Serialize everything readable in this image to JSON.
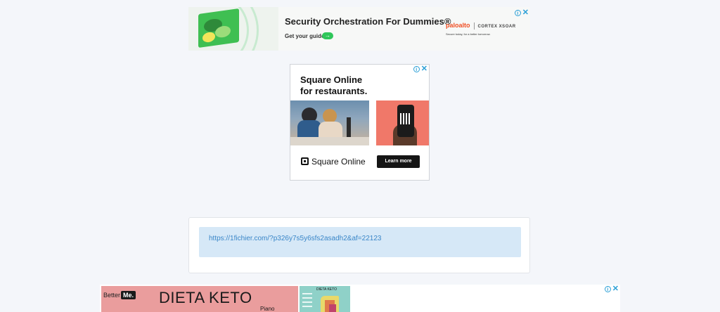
{
  "ad_top": {
    "title": "Security Orchestration For Dummies®",
    "cta": "Get your guide",
    "cta_arrow": "→",
    "brand_logo": "paloalto",
    "brand_product": "CORTEX XSOAR",
    "tagline": "Secure today, for a better tomorrow.",
    "info_icon": "i",
    "close_icon": "✕"
  },
  "ad_square": {
    "headline_line1": "Square Online",
    "headline_line2": "for restaurants.",
    "brand_name": "Square Online",
    "cta": "Learn more",
    "info_icon": "i",
    "close_icon": "✕"
  },
  "link_card": {
    "url": "https://1fichier.com/?p326y7s5y6sfs2asadh2&af=22123"
  },
  "ad_bottom": {
    "brand_prefix": "Better",
    "brand_badge": "Me.",
    "headline": "DIETA KETO",
    "subline": "Piano",
    "mini_title": "DIETA KETO",
    "info_icon": "i",
    "close_icon": "✕"
  },
  "colors": {
    "page_bg": "#f4f6fa",
    "link_color": "#3a86c8",
    "link_box_bg": "#d6e8f7",
    "ad_control_color": "#2a9fd6",
    "keto_pink": "#ea9d9d"
  }
}
